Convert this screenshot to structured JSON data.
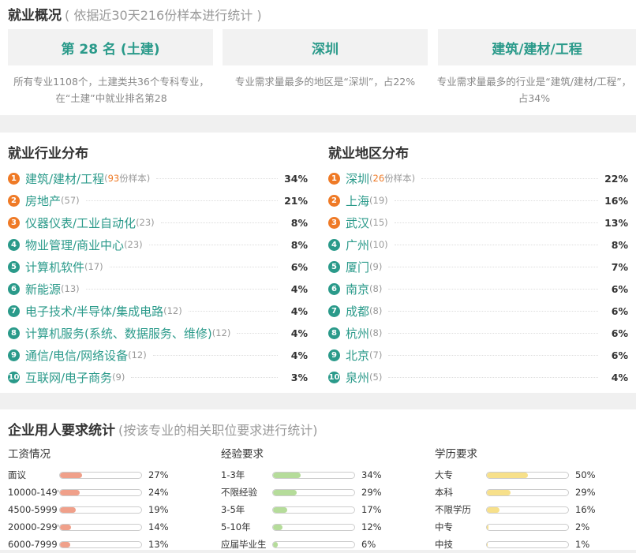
{
  "overview": {
    "title": "就业概况",
    "subtitle": "( 依据近30天216份样本进行统计 )",
    "cards": [
      {
        "label": "第 28 名 (土建)",
        "desc": "所有专业1108个，土建类共36个专科专业，在“土建”中就业排名第28"
      },
      {
        "label": "深圳",
        "desc": "专业需求量最多的地区是“深圳”，占22%"
      },
      {
        "label": "建筑/建材/工程",
        "desc": "专业需求量最多的行业是“建筑/建材/工程”，占34%"
      }
    ]
  },
  "industry": {
    "title": "就业行业分布",
    "sample_suffix": "份样本",
    "items": [
      {
        "rank": "1",
        "name": "建筑/建材/工程",
        "count": "93",
        "pct": "34%"
      },
      {
        "rank": "2",
        "name": "房地产",
        "count": "(57)",
        "pct": "21%"
      },
      {
        "rank": "3",
        "name": "仪器仪表/工业自动化",
        "count": "(23)",
        "pct": "8%"
      },
      {
        "rank": "4",
        "name": "物业管理/商业中心",
        "count": "(23)",
        "pct": "8%"
      },
      {
        "rank": "5",
        "name": "计算机软件",
        "count": "(17)",
        "pct": "6%"
      },
      {
        "rank": "6",
        "name": "新能源",
        "count": "(13)",
        "pct": "4%"
      },
      {
        "rank": "7",
        "name": "电子技术/半导体/集成电路",
        "count": "(12)",
        "pct": "4%"
      },
      {
        "rank": "8",
        "name": "计算机服务(系统、数据服务、维修)",
        "count": "(12)",
        "pct": "4%"
      },
      {
        "rank": "9",
        "name": "通信/电信/网络设备",
        "count": "(12)",
        "pct": "4%"
      },
      {
        "rank": "10",
        "name": "互联网/电子商务",
        "count": "(9)",
        "pct": "3%"
      }
    ]
  },
  "region": {
    "title": "就业地区分布",
    "sample_suffix": "份样本",
    "items": [
      {
        "rank": "1",
        "name": "深圳",
        "count": "26",
        "pct": "22%"
      },
      {
        "rank": "2",
        "name": "上海",
        "count": "(19)",
        "pct": "16%"
      },
      {
        "rank": "3",
        "name": "武汉",
        "count": "(15)",
        "pct": "13%"
      },
      {
        "rank": "4",
        "name": "广州",
        "count": "(10)",
        "pct": "8%"
      },
      {
        "rank": "5",
        "name": "厦门",
        "count": "(9)",
        "pct": "7%"
      },
      {
        "rank": "6",
        "name": "南京",
        "count": "(8)",
        "pct": "6%"
      },
      {
        "rank": "7",
        "name": "成都",
        "count": "(8)",
        "pct": "6%"
      },
      {
        "rank": "8",
        "name": "杭州",
        "count": "(8)",
        "pct": "6%"
      },
      {
        "rank": "9",
        "name": "北京",
        "count": "(7)",
        "pct": "6%"
      },
      {
        "rank": "10",
        "name": "泉州",
        "count": "(5)",
        "pct": "4%"
      }
    ]
  },
  "requirements": {
    "title": "企业用人要求统计",
    "subtitle": "(按该专业的相关职位要求进行统计)",
    "columns": [
      {
        "title": "工资情况",
        "color": "#f0a08a",
        "rows": [
          {
            "label": "面议",
            "pct": "27%",
            "value": 27
          },
          {
            "label": "10000-14999",
            "pct": "24%",
            "value": 24
          },
          {
            "label": "4500-5999",
            "pct": "19%",
            "value": 19
          },
          {
            "label": "20000-29999",
            "pct": "14%",
            "value": 14
          },
          {
            "label": "6000-7999",
            "pct": "13%",
            "value": 13
          }
        ]
      },
      {
        "title": "经验要求",
        "color": "#b5dc9a",
        "rows": [
          {
            "label": "1-3年",
            "pct": "34%",
            "value": 34
          },
          {
            "label": "不限经验",
            "pct": "29%",
            "value": 29
          },
          {
            "label": "3-5年",
            "pct": "17%",
            "value": 17
          },
          {
            "label": "5-10年",
            "pct": "12%",
            "value": 12
          },
          {
            "label": "应届毕业生",
            "pct": "6%",
            "value": 6
          }
        ]
      },
      {
        "title": "学历要求",
        "color": "#f7e08a",
        "rows": [
          {
            "label": "大专",
            "pct": "50%",
            "value": 50
          },
          {
            "label": "本科",
            "pct": "29%",
            "value": 29
          },
          {
            "label": "不限学历",
            "pct": "16%",
            "value": 16
          },
          {
            "label": "中专",
            "pct": "2%",
            "value": 2
          },
          {
            "label": "中技",
            "pct": "1%",
            "value": 1
          }
        ]
      }
    ]
  }
}
